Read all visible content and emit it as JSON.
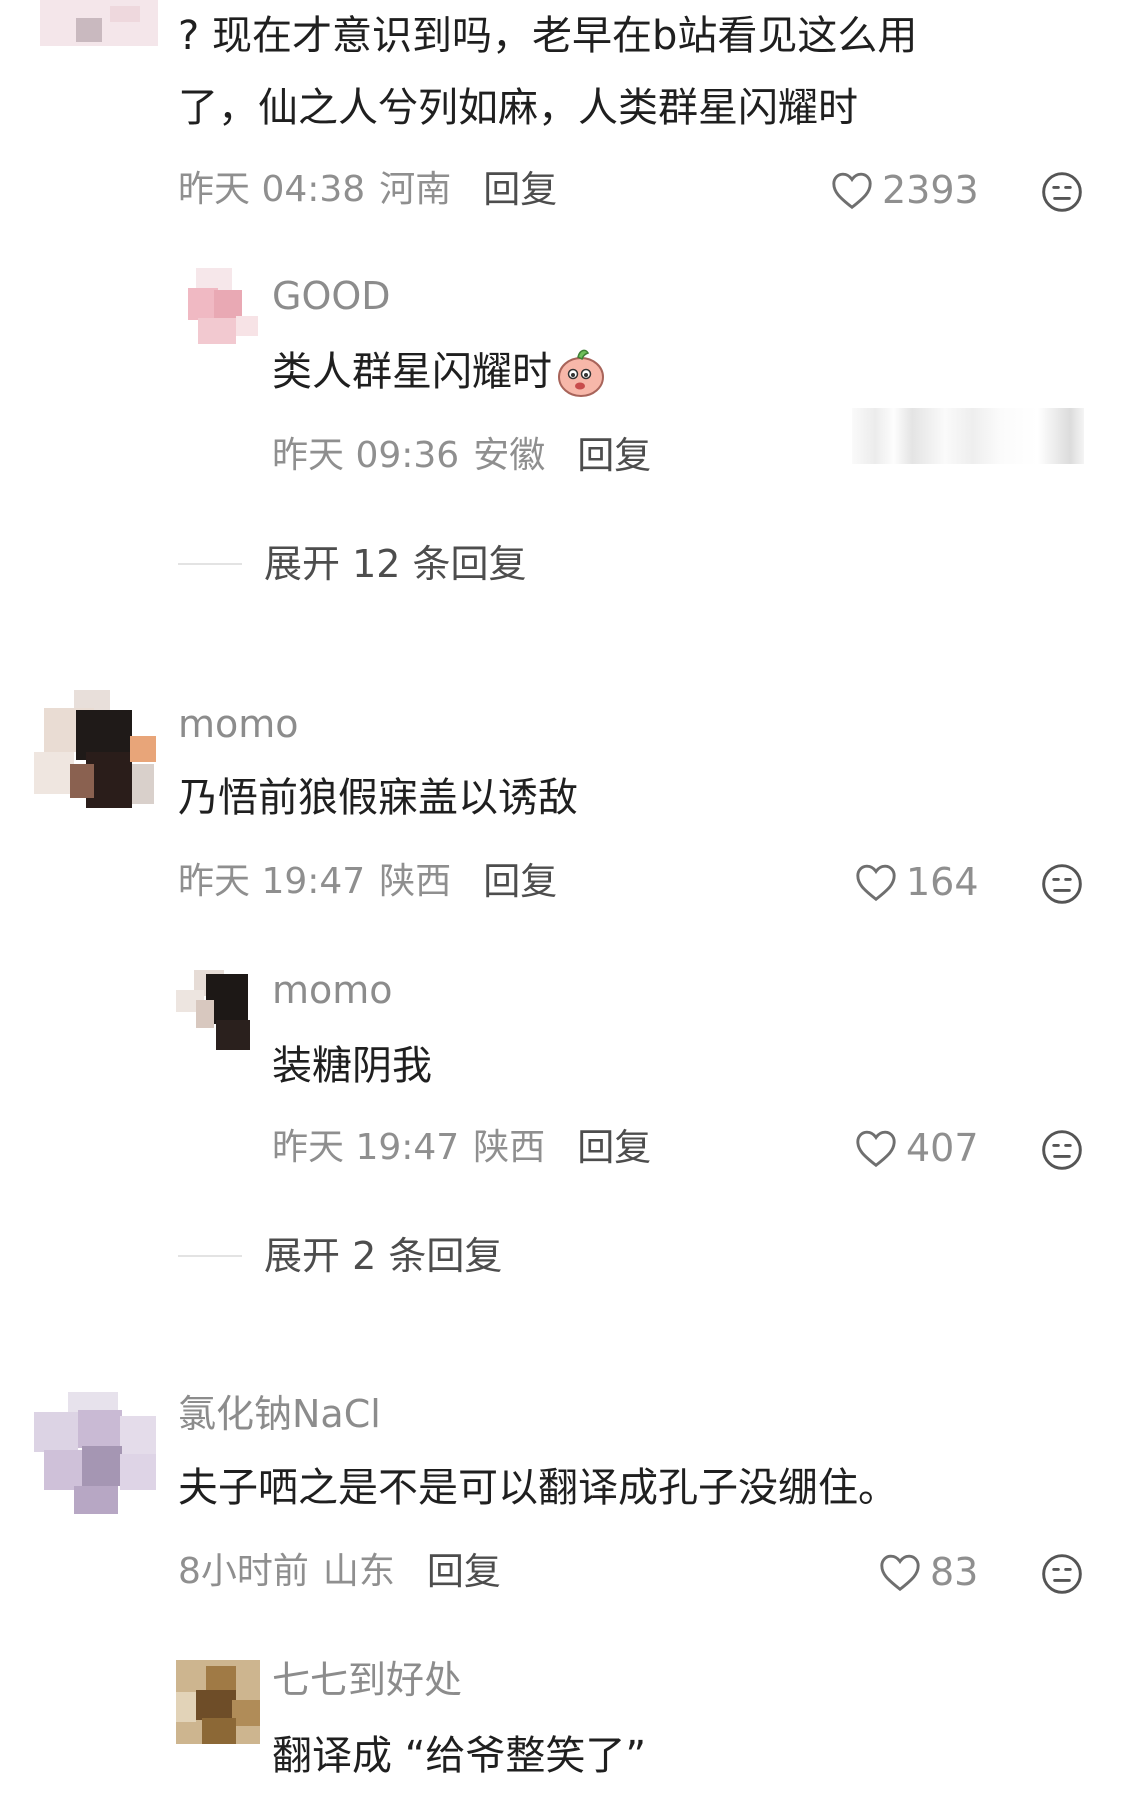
{
  "comments": [
    {
      "text_lines": [
        "? 现在才意识到吗，老早在b站看见这么用",
        "了，仙之人兮列如麻，人类群星闪耀时"
      ],
      "time": "昨天 04:38",
      "location": "河南",
      "reply_label": "回复",
      "likes": "2393",
      "replies": [
        {
          "username": "GOOD",
          "text": "类人群星闪耀时",
          "time": "昨天 09:36",
          "location": "安徽",
          "reply_label": "回复"
        }
      ],
      "expand_label": "展开 12 条回复"
    },
    {
      "username": "momo",
      "text": "乃悟前狼假寐盖以诱敌",
      "time": "昨天 19:47",
      "location": "陕西",
      "reply_label": "回复",
      "likes": "164",
      "replies": [
        {
          "username": "momo",
          "text": "装糖阴我",
          "time": "昨天 19:47",
          "location": "陕西",
          "reply_label": "回复",
          "likes": "407"
        }
      ],
      "expand_label": "展开 2 条回复"
    },
    {
      "username": "氯化钠NaCl",
      "text": "夫子哂之是不是可以翻译成孔子没绷住。",
      "time": "8小时前",
      "location": "山东",
      "reply_label": "回复",
      "likes": "83",
      "replies": [
        {
          "username": "七七到好处",
          "text": "翻译成 “给爷整笑了”"
        }
      ]
    }
  ],
  "icons": {
    "like": "heart-outline-icon",
    "dislike": "dislike-face-icon",
    "emoji": "peach-emoji-icon"
  },
  "colors": {
    "text_primary": "#1f1f1f",
    "text_secondary": "#8f8f8f",
    "reply_button": "#4d4d4d"
  }
}
